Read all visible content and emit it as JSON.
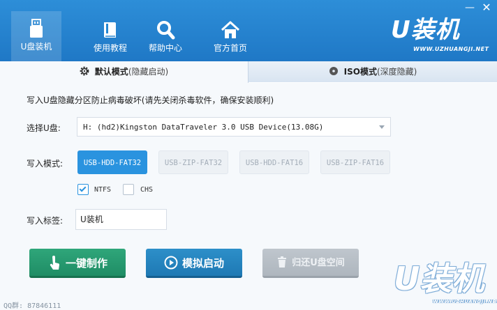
{
  "window": {
    "minimize_glyph": "—",
    "close_glyph": "✕"
  },
  "nav": {
    "items": [
      {
        "label": "U盘装机",
        "icon": "usb-drive-icon",
        "active": true
      },
      {
        "label": "使用教程",
        "icon": "book-icon",
        "active": false
      },
      {
        "label": "帮助中心",
        "icon": "search-icon",
        "active": false
      },
      {
        "label": "官方首页",
        "icon": "home-icon",
        "active": false
      }
    ]
  },
  "logo": {
    "text": "U装机",
    "url": "WWW.UZHUANGJI.NET"
  },
  "tabs": [
    {
      "title": "默认模式",
      "subtitle": "(隐藏启动)",
      "icon": "gear-icon",
      "active": true
    },
    {
      "title": "ISO模式",
      "subtitle": "(深度隐藏)",
      "icon": "disc-icon",
      "active": false
    }
  ],
  "notice": "写入U盘隐藏分区防止病毒破坏(请先关闭杀毒软件，确保安装顺利)",
  "disk": {
    "label": "选择U盘:",
    "value": "H: (hd2)Kingston DataTraveler 3.0 USB Device(13.08G)"
  },
  "write_mode": {
    "label": "写入模式:",
    "options": [
      "USB-HDD-FAT32",
      "USB-ZIP-FAT32",
      "USB-HDD-FAT16",
      "USB-ZIP-FAT16"
    ],
    "selected": "USB-HDD-FAT32"
  },
  "checks": [
    {
      "label": "NTFS",
      "checked": true
    },
    {
      "label": "CHS",
      "checked": false
    }
  ],
  "volume_label": {
    "label": "写入标签:",
    "value": "U装机"
  },
  "actions": {
    "make": "一键制作",
    "simulate": "模拟启动",
    "restore": "归还U盘空间"
  },
  "footer": {
    "qq": "QQ群: 87846111"
  },
  "colors": {
    "header": "#2486d2",
    "accent": "#2a93df",
    "make_button": "#27996f",
    "sim_button": "#2486c0",
    "disabled_button": "#b6bec6"
  }
}
